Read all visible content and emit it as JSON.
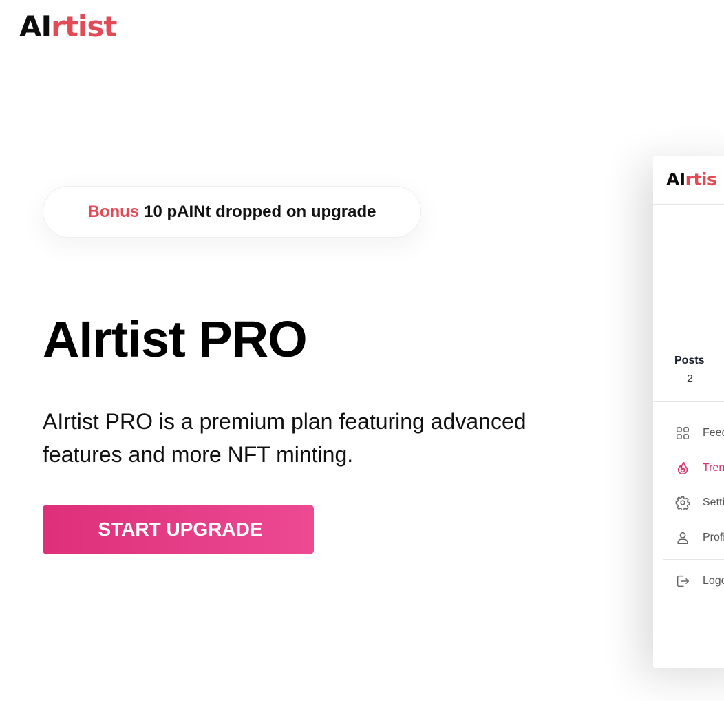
{
  "brand": {
    "logo_ai": "AI",
    "logo_rtist": "rtist",
    "accent_color": "#e24a55",
    "cta_gradient": [
      "#de2f7a",
      "#ec4a93"
    ]
  },
  "hero": {
    "bonus_accent": "Bonus",
    "bonus_text": "10 pAINt dropped on upgrade",
    "title": "AIrtist PRO",
    "description": "AIrtist PRO is a premium plan featuring advanced features and more NFT minting.",
    "cta_label": "START UPGRADE"
  },
  "preview": {
    "logo_ai": "AI",
    "logo_rtist": "rtis",
    "stat_label": "Posts",
    "stat_value": "2",
    "nav": [
      {
        "label": "Feed",
        "icon": "grid-icon",
        "active": false
      },
      {
        "label": "Trending",
        "icon": "flame-icon",
        "active": true
      },
      {
        "label": "Settings",
        "icon": "gear-icon",
        "active": false
      },
      {
        "label": "Profile",
        "icon": "user-icon",
        "active": false
      },
      {
        "label": "Logout",
        "icon": "logout-icon",
        "active": false
      }
    ]
  }
}
